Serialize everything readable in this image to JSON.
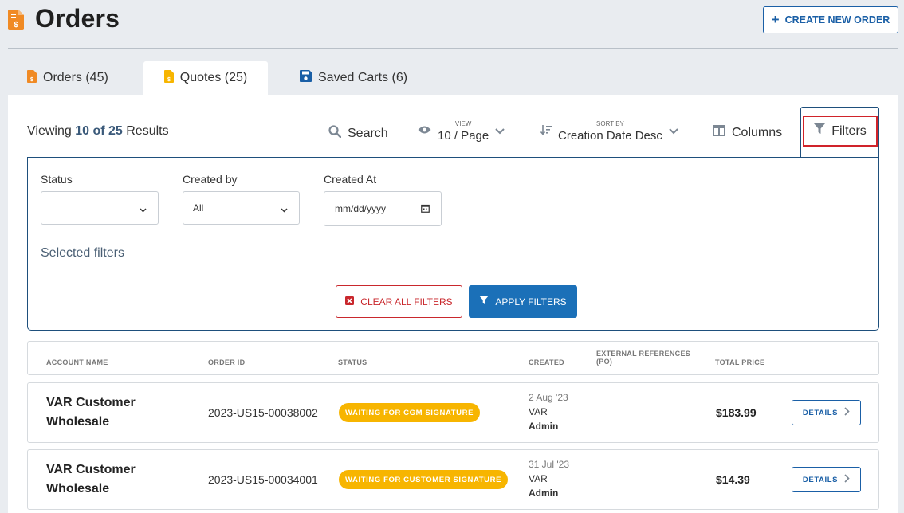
{
  "header": {
    "title": "Orders",
    "create_button": "CREATE NEW ORDER"
  },
  "tabs": [
    {
      "label": "Orders (45)",
      "icon": "orders-doc-icon",
      "active": false
    },
    {
      "label": "Quotes (25)",
      "icon": "quote-doc-icon",
      "active": true
    },
    {
      "label": "Saved Carts (6)",
      "icon": "floppy-disk-icon",
      "active": false
    }
  ],
  "toolbar": {
    "viewing_prefix": "Viewing",
    "viewing_count": "10 of 25",
    "viewing_suffix": "Results",
    "search_label": "Search",
    "view_caption": "VIEW",
    "view_value": "10 / Page",
    "sort_caption": "SORT BY",
    "sort_value": "Creation Date Desc",
    "columns_label": "Columns",
    "filters_label": "Filters"
  },
  "filters": {
    "status_label": "Status",
    "status_value": "",
    "created_by_label": "Created by",
    "created_by_value": "All",
    "created_at_label": "Created At",
    "created_at_placeholder": "mm/dd/yyyy",
    "selected_filters_label": "Selected filters",
    "clear_button": "CLEAR ALL FILTERS",
    "apply_button": "APPLY FILTERS"
  },
  "table": {
    "columns": [
      "ACCOUNT NAME",
      "ORDER ID",
      "STATUS",
      "CREATED",
      "EXTERNAL REFERENCES (PO)",
      "TOTAL PRICE"
    ],
    "rows": [
      {
        "account_line1": "VAR Customer",
        "account_line2": "Wholesale",
        "order_id": "2023-US15-00038002",
        "status": "WAITING FOR CGM SIGNATURE",
        "created_date": "2 Aug '23",
        "created_by_line1": "VAR",
        "created_by_line2": "Admin",
        "external_ref": "",
        "total_price": "$183.99",
        "details_label": "DETAILS"
      },
      {
        "account_line1": "VAR Customer",
        "account_line2": "Wholesale",
        "order_id": "2023-US15-00034001",
        "status": "WAITING FOR CUSTOMER SIGNATURE",
        "created_date": "31 Jul '23",
        "created_by_line1": "VAR",
        "created_by_line2": "Admin",
        "external_ref": "",
        "total_price": "$14.39",
        "details_label": "DETAILS"
      }
    ]
  },
  "colors": {
    "accent_blue": "#1a5fa6",
    "apply_blue": "#1b70b8",
    "status_yellow": "#f7b500",
    "doc_orange": "#f08a24",
    "clear_red": "#c9282d",
    "background": "#e9ecf0"
  }
}
